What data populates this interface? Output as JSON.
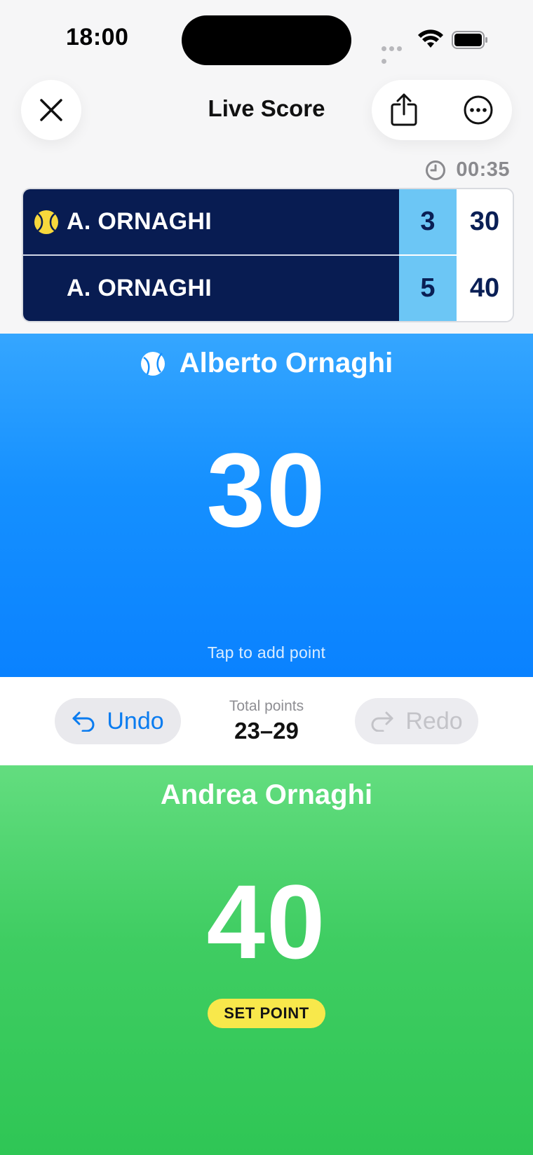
{
  "status_bar": {
    "time": "18:00"
  },
  "header": {
    "title": "Live Score"
  },
  "timer": {
    "elapsed": "00:35"
  },
  "scoreboard": {
    "rows": [
      {
        "name": "A. ORNAGHI",
        "games": "3",
        "points": "30",
        "serving": true
      },
      {
        "name": "A. ORNAGHI",
        "games": "5",
        "points": "40",
        "serving": false
      }
    ]
  },
  "player1": {
    "name": "Alberto Ornaghi",
    "score": "30",
    "hint": "Tap to add point"
  },
  "controls": {
    "undo_label": "Undo",
    "redo_label": "Redo",
    "total_label": "Total points",
    "total_value": "23–29"
  },
  "player2": {
    "name": "Andrea Ornaghi",
    "score": "40",
    "badge": "SET POINT"
  },
  "colors": {
    "scoreboard_bg": "#081c52",
    "games_bg": "#6cc6f5",
    "player1_bg": "#1590ff",
    "player2_bg": "#3fcd62",
    "set_point_bg": "#f8e84b",
    "accent": "#0a7cf0"
  },
  "icons": {
    "close": "close-icon",
    "share": "share-icon",
    "more": "more-icon",
    "clock": "clock-icon",
    "serve": "tennis-ball-icon",
    "undo": "undo-arrow-icon",
    "redo": "redo-arrow-icon"
  }
}
